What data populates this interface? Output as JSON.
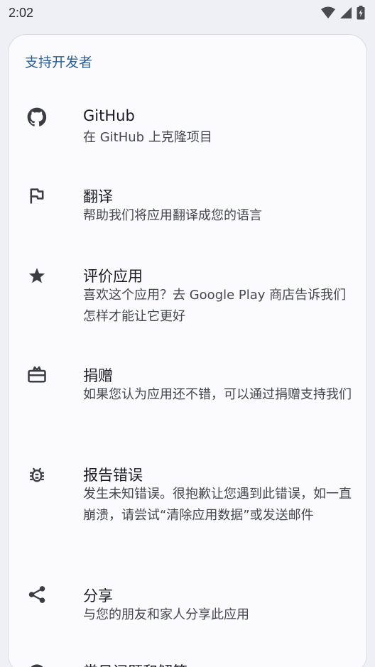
{
  "status_bar": {
    "time": "2:02"
  },
  "section_title": "支持开发者",
  "items": [
    {
      "title": "GitHub",
      "subtitle": "在 GitHub 上克隆项目",
      "icon": "github-icon"
    },
    {
      "title": "翻译",
      "subtitle": "帮助我们将应用翻译成您的语言",
      "icon": "flag-icon"
    },
    {
      "title": "评价应用",
      "subtitle": "喜欢这个应用？去 Google Play 商店告诉我们怎样才能让它更好",
      "icon": "star-icon"
    },
    {
      "title": "捐赠",
      "subtitle": "如果您认为应用还不错，可以通过捐赠支持我们",
      "icon": "gift-card-icon"
    },
    {
      "title": "报告错误",
      "subtitle": "发生未知错误。很抱歉让您遇到此错误，如一直崩溃，请尝试“清除应用数据”或发送邮件",
      "icon": "bug-icon"
    },
    {
      "title": "分享",
      "subtitle": "与您的朋友和家人分享此应用",
      "icon": "share-icon"
    },
    {
      "title": "常见问题和解答",
      "subtitle": "",
      "icon": "help-icon"
    }
  ]
}
